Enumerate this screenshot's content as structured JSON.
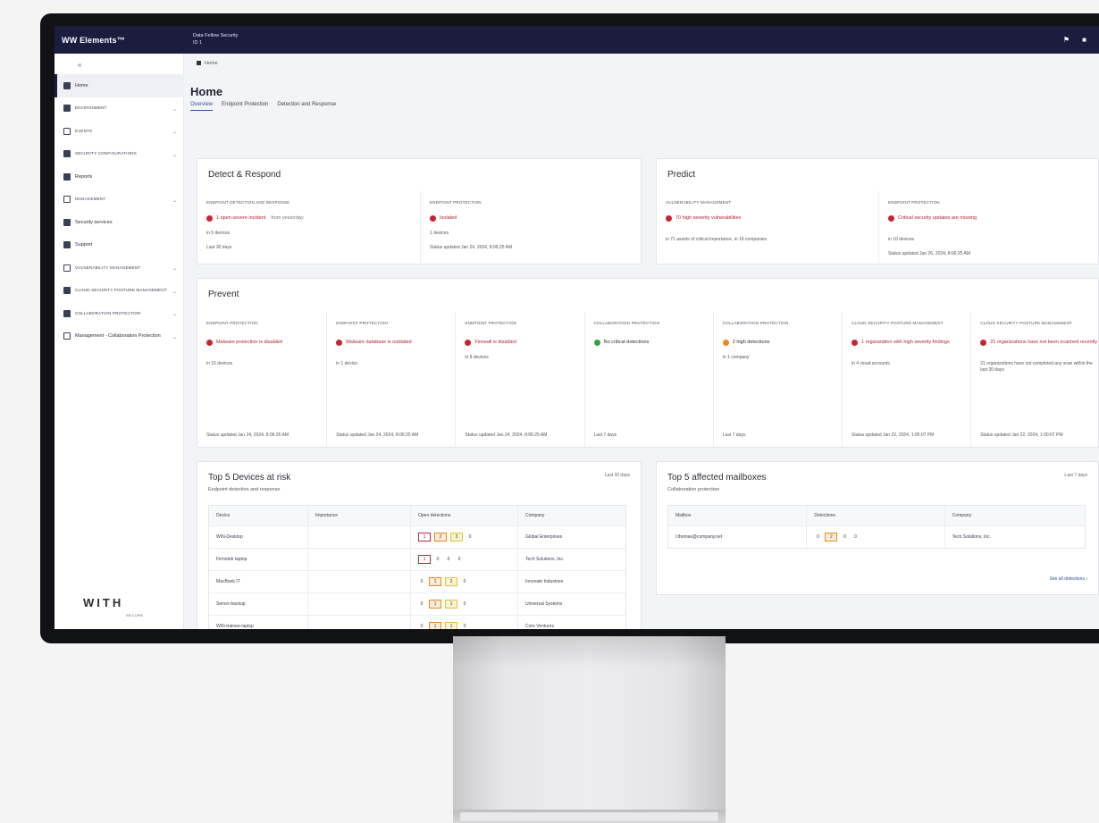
{
  "app": {
    "brand": "WW Elements™",
    "org_line1": "Data Fellow Security",
    "org_line2": "ID 1"
  },
  "breadcrumb": "Home",
  "page_title": "Home",
  "tabs": [
    {
      "label": "Overview",
      "active": true
    },
    {
      "label": "Endpoint Protection",
      "active": false
    },
    {
      "label": "Detection and Response",
      "active": false
    }
  ],
  "sidebar": {
    "collapse_glyph": "«",
    "items": [
      {
        "label": "Home",
        "small": false,
        "chevron": false,
        "active": true,
        "icon": "home-icon"
      },
      {
        "label": "Environment",
        "small": true,
        "chevron": true,
        "active": false,
        "icon": "grid-icon"
      },
      {
        "label": "Events",
        "small": true,
        "chevron": true,
        "active": false,
        "icon": "bolt-icon"
      },
      {
        "label": "Security configurations",
        "small": true,
        "chevron": true,
        "active": false,
        "icon": "wrench-icon"
      },
      {
        "label": "Reports",
        "small": false,
        "chevron": false,
        "active": false,
        "icon": "chart-icon"
      },
      {
        "label": "Management",
        "small": true,
        "chevron": true,
        "active": false,
        "icon": "gear-icon"
      },
      {
        "label": "Security services",
        "small": false,
        "chevron": false,
        "active": false,
        "icon": "list-icon"
      },
      {
        "label": "Support",
        "small": false,
        "chevron": false,
        "active": false,
        "icon": "support-icon"
      },
      {
        "label": "Vulnerability management",
        "small": true,
        "chevron": true,
        "active": false,
        "icon": "scan-icon"
      },
      {
        "label": "Cloud security posture management",
        "small": true,
        "chevron": true,
        "active": false,
        "icon": "cloud-icon"
      },
      {
        "label": "Collaboration protection",
        "small": true,
        "chevron": true,
        "active": false,
        "icon": "shield-icon"
      },
      {
        "label": "Management - Collaboration Protection",
        "small": false,
        "chevron": true,
        "active": false,
        "icon": "users-icon"
      }
    ],
    "footer_logo": "WITH",
    "footer_sub": "SECURE"
  },
  "detect": {
    "title": "Detect & Respond",
    "cells": [
      {
        "label": "Endpoint detection and response",
        "status": "1 open severe incident",
        "extra": "from yesterday",
        "lines": [
          "in 5 devices",
          "Last 30 days"
        ]
      },
      {
        "label": "Endpoint protection",
        "status": "Isolated",
        "lines": [
          "1 devices",
          "Status updated Jan 24, 2024, 8:06:25 AM"
        ]
      }
    ]
  },
  "predict": {
    "title": "Predict",
    "cells": [
      {
        "label": "Vulnerability management",
        "status": "70 high severity vulnerabilities",
        "lines": [
          "in 71 assets of critical importance, in 19 companies"
        ]
      },
      {
        "label": "Endpoint protection",
        "status": "Critical security updates are missing",
        "lines": [
          "in 10 devices",
          "Status updated Jan 26, 2024, 8:06:25 AM"
        ]
      }
    ]
  },
  "prevent": {
    "title": "Prevent",
    "cells": [
      {
        "label": "Endpoint protection",
        "status": "Malware protection is disabled",
        "tone": "red",
        "lines": [
          "in 15 devices"
        ],
        "footer": "Status updated Jan 24, 2024, 8:06:25 AM"
      },
      {
        "label": "Endpoint protection",
        "status": "Malware database is outdated",
        "tone": "red",
        "lines": [
          "in 1 device"
        ],
        "footer": "Status updated Jan 24, 2024, 8:06:25 AM"
      },
      {
        "label": "Endpoint protection",
        "status": "Firewall is disabled",
        "tone": "red",
        "lines": [
          "in 8 devices"
        ],
        "footer": "Status updated Jan 24, 2024, 8:06:25 AM"
      },
      {
        "label": "Collaboration protection",
        "status": "No critical detections",
        "tone": "green",
        "lines": [],
        "footer": "Last 7 days"
      },
      {
        "label": "Collaboration protection",
        "status": "2 high detections",
        "tone": "orange",
        "lines": [
          "in 1 company"
        ],
        "footer": "Last 7 days"
      },
      {
        "label": "Cloud security posture management",
        "status": "1 organization with high severity findings",
        "tone": "red",
        "lines": [
          "in 4 cloud accounts"
        ],
        "footer": "Status updated Jan 22, 2024, 1:00:07 PM"
      },
      {
        "label": "Cloud security posture management",
        "status": "21 organizations have not been scanned recently",
        "tone": "red",
        "lines": [
          "21 organizations have not completed any scan within the last 30 days"
        ],
        "footer": "Status updated Jan 22, 2024, 1:00:07 PM"
      }
    ]
  },
  "devices": {
    "title": "Top 5 Devices at risk",
    "subtitle": "Endpoint detection and response",
    "link": "Last 30 days",
    "columns": [
      "Device",
      "Importance",
      "Open detections",
      "Company"
    ],
    "rows": [
      {
        "device": "WIN-Desktop",
        "importance": "",
        "counts": [
          "1",
          "2",
          "3",
          "0"
        ],
        "company": "Global Enterprises"
      },
      {
        "device": "Firmsteb laptop",
        "importance": "",
        "counts": [
          "1",
          "0",
          "0",
          "0"
        ],
        "company": "Tech Solutions, Inc."
      },
      {
        "device": "MacBook IT",
        "importance": "",
        "counts": [
          "0",
          "1",
          "3",
          "0"
        ],
        "company": "Innovate Industries"
      },
      {
        "device": "Server-backup",
        "importance": "",
        "counts": [
          "0",
          "1",
          "1",
          "0"
        ],
        "company": "Universal Systems"
      },
      {
        "device": "WIN-trainee-laptop",
        "importance": "",
        "counts": [
          "0",
          "1",
          "1",
          "0"
        ],
        "company": "Core Ventures"
      }
    ]
  },
  "mailboxes": {
    "title": "Top 5 affected mailboxes",
    "subtitle": "Collaboration protection",
    "link": "Last 7 days",
    "columns": [
      "Mailbox",
      "Detections",
      "Company"
    ],
    "rows": [
      {
        "mailbox": "l.thomas@company.net",
        "counts": [
          "0",
          "2",
          "0",
          "0"
        ],
        "company": "Tech Solutions, Inc."
      }
    ],
    "see_all": "See all detections ›"
  }
}
